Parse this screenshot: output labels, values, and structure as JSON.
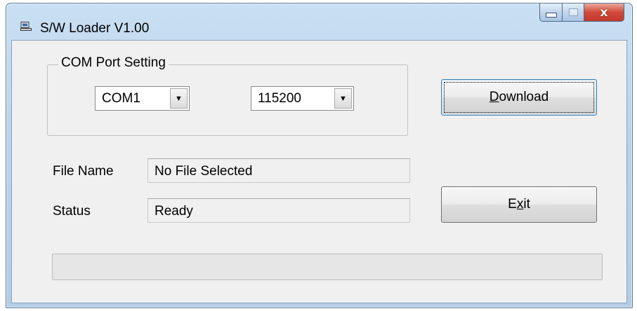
{
  "window": {
    "title": "S/W Loader V1.00",
    "icons": {
      "app": "computer-icon",
      "minimize": "minimize-icon",
      "maximize": "maximize-icon",
      "close": "close-icon"
    },
    "close_glyph": "x"
  },
  "com_port": {
    "group_label": "COM Port Setting",
    "port": {
      "selected": "COM1"
    },
    "baud": {
      "selected": "115200"
    },
    "dropdown_glyph": "▼"
  },
  "file": {
    "label": "File Name",
    "value": "No File Selected"
  },
  "status": {
    "label": "Status",
    "value": "Ready"
  },
  "buttons": {
    "download": {
      "label_prefix": "",
      "mnemonic": "D",
      "label_rest": "ownload"
    },
    "exit": {
      "label_prefix": "E",
      "mnemonic": "x",
      "label_rest": "it"
    }
  },
  "progress": {
    "fraction": 0
  },
  "colors": {
    "title_bar": "#b9d3ec",
    "client_bg": "#f0f0f0",
    "close_button": "#c0392b",
    "progress_fill": "#06b025"
  }
}
